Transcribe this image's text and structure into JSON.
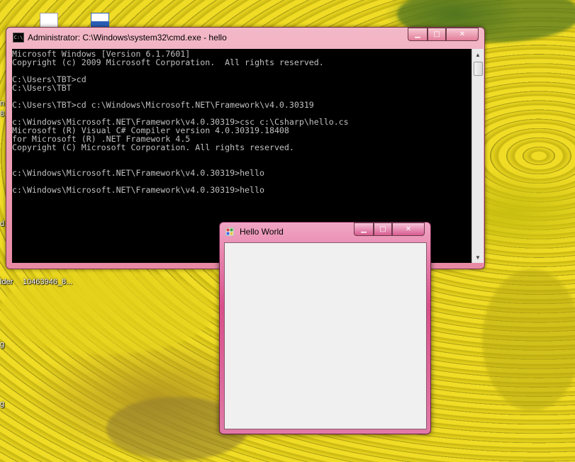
{
  "desktop": {
    "labels": [
      "lder",
      "10463946_8..."
    ],
    "edge_fragments": [
      "d",
      "g",
      "g",
      "n",
      "8"
    ]
  },
  "cmd_window": {
    "title": "Administrator: C:\\Windows\\system32\\cmd.exe - hello",
    "icon_text": "C:\\",
    "minimize": "▁",
    "maximize": "□",
    "close": "✕",
    "lines": [
      "Microsoft Windows [Version 6.1.7601]",
      "Copyright (c) 2009 Microsoft Corporation.  All rights reserved.",
      "",
      "C:\\Users\\TBT>cd",
      "C:\\Users\\TBT",
      "",
      "C:\\Users\\TBT>cd c:\\Windows\\Microsoft.NET\\Framework\\v4.0.30319",
      "",
      "c:\\Windows\\Microsoft.NET\\Framework\\v4.0.30319>csc c:\\Csharp\\hello.cs",
      "Microsoft (R) Visual C# Compiler version 4.0.30319.18408",
      "for Microsoft (R) .NET Framework 4.5",
      "Copyright (C) Microsoft Corporation. All rights reserved.",
      "",
      "",
      "c:\\Windows\\Microsoft.NET\\Framework\\v4.0.30319>hello",
      "",
      "c:\\Windows\\Microsoft.NET\\Framework\\v4.0.30319>hello"
    ],
    "scroll_up": "▲",
    "scroll_down": "▼"
  },
  "hello_window": {
    "title": "Hello World",
    "minimize": "▁",
    "maximize": "□",
    "close": "✕"
  }
}
